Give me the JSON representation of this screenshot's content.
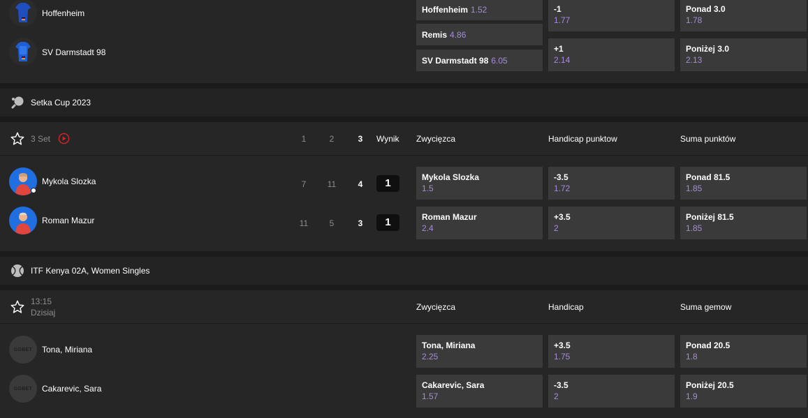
{
  "match1": {
    "teams": [
      {
        "name": "Hoffenheim"
      },
      {
        "name": "SV Darmstadt 98"
      }
    ],
    "winner": [
      {
        "label": "Hoffenheim",
        "odd": "1.52"
      },
      {
        "label": "Remis",
        "odd": "4.86"
      },
      {
        "label": "SV Darmstadt 98",
        "odd": "6.05"
      }
    ],
    "handicap": [
      {
        "label": "-1",
        "odd": "1.77"
      },
      {
        "label": "+1",
        "odd": "2.14"
      }
    ],
    "total": [
      {
        "label": "Ponad 3.0",
        "odd": "1.78"
      },
      {
        "label": "Poniżej 3.0",
        "odd": "2.13"
      }
    ]
  },
  "league2": {
    "name": "Setka Cup 2023",
    "status": "3 Set",
    "set_headers": [
      "1",
      "2",
      "3"
    ],
    "result_header": "Wynik",
    "col_winner": "Zwycięzca",
    "col_handicap": "Handicap punktow",
    "col_total": "Suma punktów",
    "players": [
      {
        "name": "Mykola Slozka",
        "sets": [
          "7",
          "11",
          "4"
        ],
        "result": "1",
        "winner": {
          "label": "Mykola Slozka",
          "odd": "1.5"
        },
        "handicap": {
          "label": "-3.5",
          "odd": "1.72"
        },
        "total": {
          "label": "Ponad 81.5",
          "odd": "1.85"
        }
      },
      {
        "name": "Roman Mazur",
        "sets": [
          "11",
          "5",
          "3"
        ],
        "result": "1",
        "winner": {
          "label": "Roman Mazur",
          "odd": "2.4"
        },
        "handicap": {
          "label": "+3.5",
          "odd": "2"
        },
        "total": {
          "label": "Poniżej 81.5",
          "odd": "1.85"
        }
      }
    ]
  },
  "league3": {
    "name": "ITF Kenya 02A, Women Singles",
    "time": "13:15",
    "day": "Dzisiaj",
    "col_winner": "Zwycięzca",
    "col_handicap": "Handicap",
    "col_total": "Suma gemow",
    "avatar_text": "GGBET",
    "players": [
      {
        "name": "Tona, Miriana",
        "winner": {
          "label": "Tona, Miriana",
          "odd": "2.25"
        },
        "handicap": {
          "label": "+3.5",
          "odd": "1.75"
        },
        "total": {
          "label": "Ponad 20.5",
          "odd": "1.8"
        }
      },
      {
        "name": "Cakarevic, Sara",
        "winner": {
          "label": "Cakarevic, Sara",
          "odd": "1.57"
        },
        "handicap": {
          "label": "-3.5",
          "odd": "2"
        },
        "total": {
          "label": "Poniżej 20.5",
          "odd": "1.9"
        }
      }
    ]
  },
  "colors": {
    "bg": "#1b1b1b",
    "panel": "#262626",
    "odd_bg": "#3a3a3a",
    "odd_value": "#a78bdb",
    "live": "#d8232a"
  }
}
